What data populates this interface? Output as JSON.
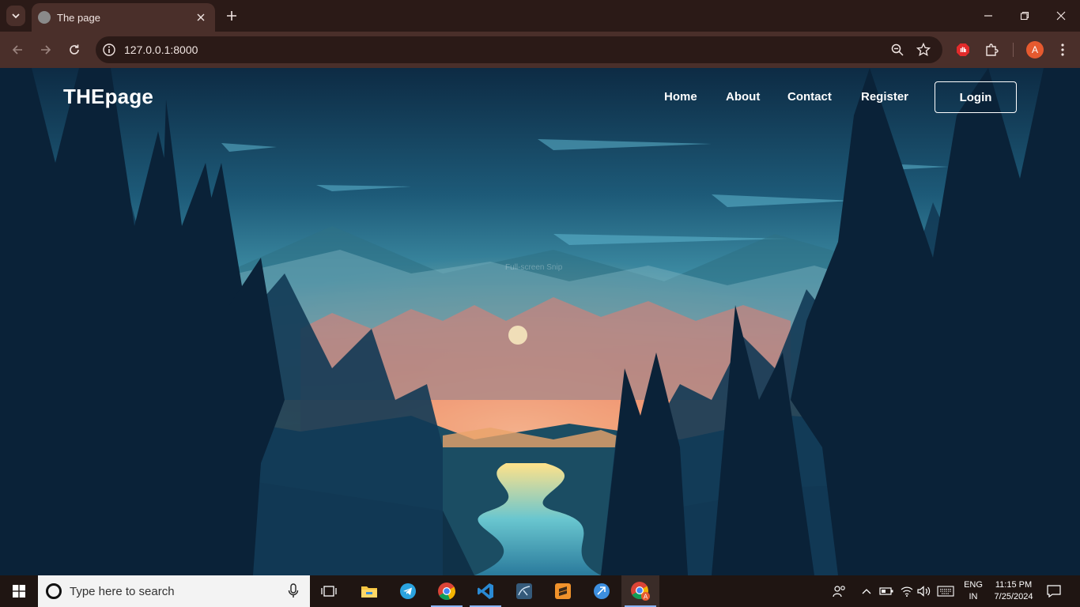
{
  "browser": {
    "tab_title": "The page",
    "url": "127.0.0.1:8000",
    "profile_initial": "A"
  },
  "site": {
    "brand": "THEpage",
    "nav": [
      "Home",
      "About",
      "Contact",
      "Register"
    ],
    "login_label": "Login",
    "overlay_text": "Full-screen Snip"
  },
  "taskbar": {
    "search_placeholder": "Type here to search",
    "language_top": "ENG",
    "language_bottom": "IN",
    "time": "11:15 PM",
    "date": "7/25/2024",
    "apps": [
      "task-view-icon",
      "file-explorer-icon",
      "telegram-icon",
      "chrome-icon",
      "vscode-icon",
      "mysql-workbench-icon",
      "sublime-text-icon",
      "qbittorrent-icon",
      "chrome-profile-icon"
    ]
  },
  "colors": {
    "chrome_dark": "#2b1a17",
    "chrome_mid": "#4a2f2a",
    "profile_accent": "#e65a2f",
    "taskbar": "#1f1512"
  }
}
